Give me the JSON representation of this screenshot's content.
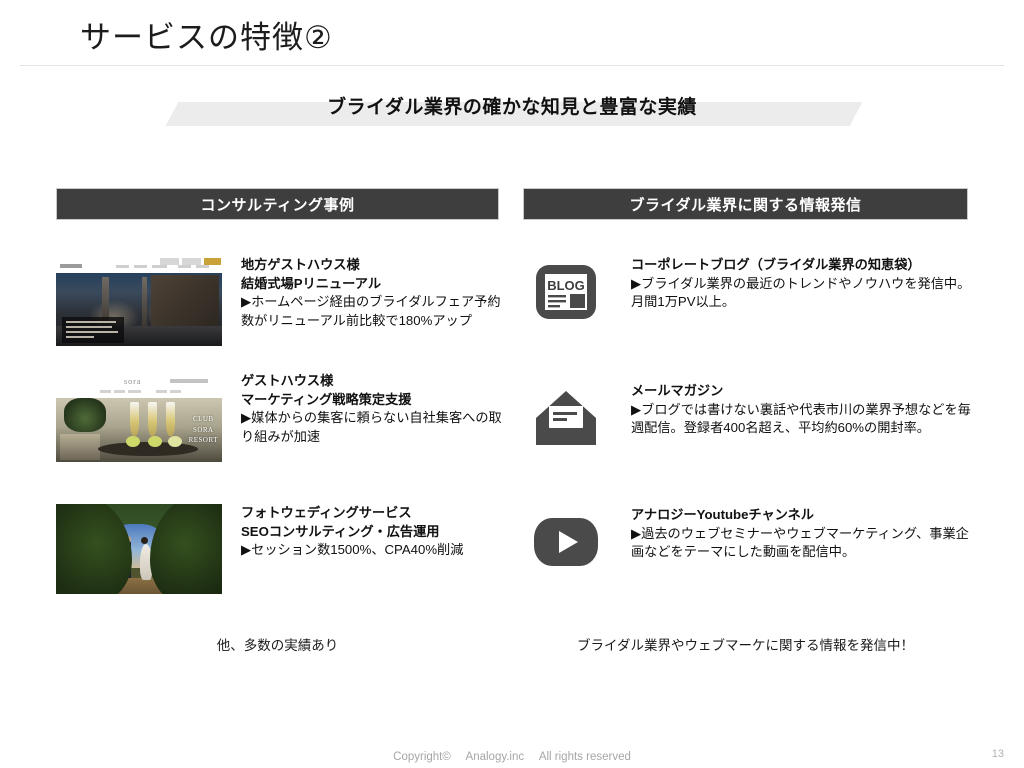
{
  "slide": {
    "title": "サービスの特徴②",
    "subtitle": "ブライダル業界の確かな知見と豊富な実績"
  },
  "columns": {
    "left": {
      "header": "コンサルティング事例",
      "caption": "他、多数の実績あり",
      "items": [
        {
          "thumbnail_name": "wedding-venue-website-thumbnail",
          "thumbnail_texts": {
            "nav_brand": "",
            "overlay": ""
          },
          "heading": "地方ゲストハウス様\n結婚式場Pリニューアル",
          "description": "▶ホームページ経由のブライダルフェア予約数がリニューアル前比較で180%アップ"
        },
        {
          "thumbnail_name": "champagne-dessert-website-thumbnail",
          "thumbnail_texts": {
            "nav_brand": "sora",
            "overlay": "CLUB\nSORA\nRESORT"
          },
          "heading": "ゲストハウス様\nマーケティング戦略策定支援",
          "description": "▶媒体からの集客に頼らない自社集客への取り組みが加速"
        },
        {
          "thumbnail_name": "beach-wedding-photo-thumbnail",
          "thumbnail_texts": {
            "nav_brand": "",
            "overlay": ""
          },
          "heading": "フォトウェディングサービス\nSEOコンサルティング・広告運用",
          "description": "▶セッション数1500%、CPA40%削減"
        }
      ]
    },
    "right": {
      "header": "ブライダル業界に関する情報発信",
      "caption": "ブライダル業界やウェブマーケに関する情報を発信中！",
      "items": [
        {
          "icon": "blog-icon",
          "icon_label": "BLOG",
          "heading": "コーポレートブログ（ブライダル業界の知恵袋）",
          "description": "▶ブライダル業界の最近のトレンドやノウハウを発信中。月間1万PV以上。"
        },
        {
          "icon": "mail-envelope-icon",
          "icon_label": "",
          "heading": "メールマガジン",
          "description": "▶ブログでは書けない裏話や代表市川の業界予想などを毎週配信。登録者400名超え、平均約60%の開封率。"
        },
        {
          "icon": "youtube-play-icon",
          "icon_label": "",
          "heading": "アナロジーYoutubeチャンネル",
          "description": "▶過去のウェブセミナーやウェブマーケティング、事業企画などをテーマにした動画を配信中。"
        }
      ]
    }
  },
  "footer": {
    "copyright": "Copyright© 　Analogy.inc 　All rights reserved",
    "page_number": "13"
  },
  "colors": {
    "header_bar": "#3e3e3e",
    "banner": "#ececec",
    "text": "#111111",
    "footer_text": "#a6a6a6"
  }
}
